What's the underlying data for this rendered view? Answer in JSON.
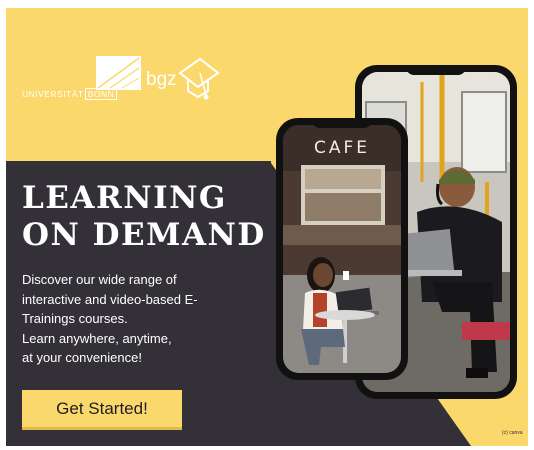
{
  "brand": {
    "university_prefix": "UNIVERSITÄT",
    "university_city": "BONN",
    "partner": "bgz"
  },
  "hero": {
    "headline_line1": "LEARNING",
    "headline_line2": "ON DEMAND",
    "description_lines": [
      "Discover our wide range of",
      "interactive and video-based E-",
      "Trainings courses.",
      "Learn anywhere, anytime,",
      "at your convenience!"
    ],
    "cta_label": "Get Started!"
  },
  "photos": {
    "cafe_sign": "CAFE"
  },
  "footer": {
    "credit": "(c) canva"
  },
  "colors": {
    "accent_yellow": "#fbd86b",
    "dark_background": "#333037",
    "text_light": "#ffffff"
  },
  "icons": [
    "university-logo-icon",
    "graduation-cap-icon",
    "phone-icon"
  ]
}
